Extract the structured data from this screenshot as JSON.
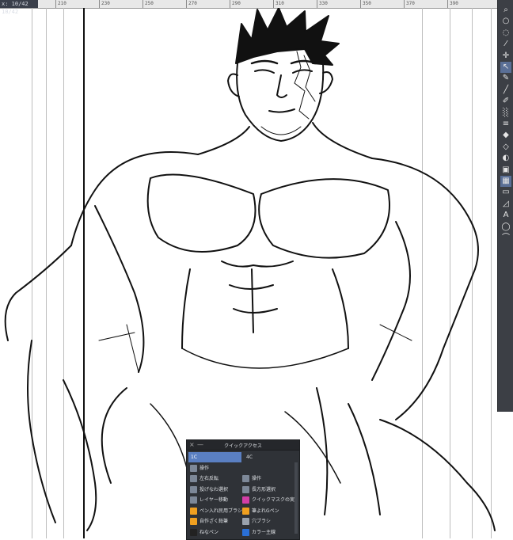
{
  "ruler": {
    "readout": "x: 10/42 10/42",
    "ticks": [
      {
        "label": "210"
      },
      {
        "label": "230"
      },
      {
        "label": "250"
      },
      {
        "label": "270"
      },
      {
        "label": "290"
      },
      {
        "label": "310"
      },
      {
        "label": "330"
      },
      {
        "label": "350"
      },
      {
        "label": "370"
      },
      {
        "label": "390"
      }
    ]
  },
  "toolbar": {
    "tools": [
      {
        "name": "zoom-icon",
        "glyph": "⌕"
      },
      {
        "name": "magnifier-icon",
        "glyph": "○"
      },
      {
        "name": "lasso-icon",
        "glyph": "◌"
      },
      {
        "name": "eyedropper-icon",
        "glyph": "⁄"
      },
      {
        "name": "move-icon",
        "glyph": "✛"
      },
      {
        "name": "object-select-icon",
        "glyph": "↖"
      },
      {
        "name": "pen-icon",
        "glyph": "✎"
      },
      {
        "name": "brush-icon",
        "glyph": "╱"
      },
      {
        "name": "pencil-icon",
        "glyph": "✐"
      },
      {
        "name": "airbrush-icon",
        "glyph": "░"
      },
      {
        "name": "decoration-icon",
        "glyph": "≡"
      },
      {
        "name": "eraser-icon",
        "glyph": "◆"
      },
      {
        "name": "blend-icon",
        "glyph": "◇"
      },
      {
        "name": "fill-icon",
        "glyph": "◐"
      },
      {
        "name": "gradient-icon",
        "glyph": "▣"
      },
      {
        "name": "layer-color-icon",
        "glyph": "▦"
      },
      {
        "name": "figure-icon",
        "glyph": "▭"
      },
      {
        "name": "ruler-icon",
        "glyph": "◿"
      },
      {
        "name": "text-icon",
        "glyph": "A"
      },
      {
        "name": "balloon-icon",
        "glyph": "◯"
      },
      {
        "name": "correction-icon",
        "glyph": "⌒"
      }
    ]
  },
  "quick_access": {
    "title": "クイックアクセス",
    "close": "×",
    "minimize": "—",
    "tabs": [
      {
        "label": "1C"
      },
      {
        "label": "4C"
      }
    ],
    "header_item": "操作",
    "items": [
      {
        "label": "左右反転",
        "color": "#7d8898"
      },
      {
        "label": "操作",
        "color": "#7d8898"
      },
      {
        "label": "投げなわ選択",
        "color": "#7d8898"
      },
      {
        "label": "長方形選択",
        "color": "#7d8898"
      },
      {
        "label": "レイヤー移動",
        "color": "#7d8898"
      },
      {
        "label": "クイックマスクの実行・非",
        "color": "#d23ea7"
      },
      {
        "label": "ペン入れ民用ブラシ",
        "color": "#f0a020"
      },
      {
        "label": "筆よれGペン",
        "color": "#f0a020"
      },
      {
        "label": "自作ざく鉛筆",
        "color": "#f0a020"
      },
      {
        "label": "穴ブラシ",
        "color": "#9aa2ad"
      },
      {
        "label": "ねなペン",
        "color": "#222222"
      },
      {
        "label": "カラー主線",
        "color": "#2a6fd6"
      }
    ]
  }
}
